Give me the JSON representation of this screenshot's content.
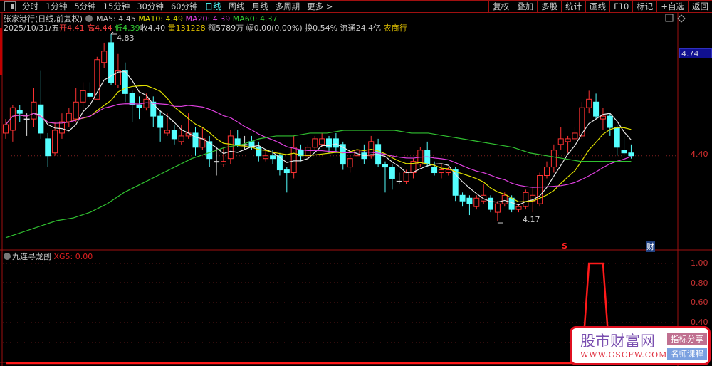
{
  "toolbar": {
    "periods": [
      "分时",
      "1分钟",
      "5分钟",
      "15分钟",
      "30分钟",
      "60分钟",
      "日线",
      "周线",
      "月线",
      "多周期",
      "更多 >"
    ],
    "active": "日线",
    "buttons": [
      "复权",
      "叠加",
      "多股",
      "统计",
      "画线",
      "F10",
      "标记",
      "+自选",
      "返回"
    ]
  },
  "header": {
    "stock": "张家港行(日线,前复权)",
    "ma5": "MA5: 4.45",
    "ma10": "MA10: 4.49",
    "ma20": "MA20: 4.39",
    "ma60": "MA60: 4.37",
    "date": "2025/10/31/五",
    "open_l": "开",
    "open": "4.41",
    "high_l": "高",
    "high": "4.44",
    "low_l": "低",
    "low": "4.39",
    "close_l": "收",
    "close": "4.40",
    "vol_l": "量",
    "vol": "131228",
    "amount": "额5789万",
    "change": "幅0.00(0.00%)",
    "turnover": "换0.54%",
    "float": "流通24.4亿",
    "sector": "农商行"
  },
  "price_axis": {
    "current_label": "4.74",
    "last_label": "4.40"
  },
  "annotations": {
    "high": "4.83",
    "low": "4.17",
    "s_marker": "S",
    "cai_marker": "财"
  },
  "sub": {
    "name": "九连寻龙副",
    "value": "XG5: 0.00",
    "axis": [
      "1.00",
      "0.80",
      "0.60",
      "0.40"
    ]
  },
  "watermark": {
    "title": "股市财富网",
    "url": "WWW.GSCFW.COM",
    "btn1": "指标分享",
    "btn2": "名师课程"
  },
  "colors": {
    "up": "#ff3232",
    "down": "#54ffff",
    "ma5": "#e6e6e6",
    "ma10": "#e0e000",
    "ma20": "#e040e0",
    "ma60": "#30c030",
    "xg5": "#ff1a1a"
  },
  "chart_data": {
    "type": "candlestick",
    "ylim": [
      4.05,
      4.9
    ],
    "ohlc": [
      [
        4.48,
        4.53,
        4.46,
        4.51
      ],
      [
        4.49,
        4.58,
        4.45,
        4.57
      ],
      [
        4.56,
        4.58,
        4.52,
        4.55
      ],
      [
        4.53,
        4.55,
        4.47,
        4.53
      ],
      [
        4.53,
        4.64,
        4.5,
        4.59
      ],
      [
        4.58,
        4.7,
        4.46,
        4.48
      ],
      [
        4.46,
        4.48,
        4.36,
        4.4
      ],
      [
        4.41,
        4.52,
        4.4,
        4.49
      ],
      [
        4.48,
        4.55,
        4.46,
        4.52
      ],
      [
        4.52,
        4.57,
        4.5,
        4.55
      ],
      [
        4.53,
        4.64,
        4.52,
        4.59
      ],
      [
        4.59,
        4.66,
        4.56,
        4.63
      ],
      [
        4.62,
        4.66,
        4.6,
        4.61
      ],
      [
        4.6,
        4.75,
        4.6,
        4.74
      ],
      [
        4.73,
        4.8,
        4.71,
        4.77
      ],
      [
        4.8,
        4.83,
        4.65,
        4.66
      ],
      [
        4.65,
        4.76,
        4.64,
        4.7
      ],
      [
        4.7,
        4.73,
        4.59,
        4.62
      ],
      [
        4.62,
        4.63,
        4.52,
        4.58
      ],
      [
        4.58,
        4.61,
        4.53,
        4.57
      ],
      [
        4.57,
        4.62,
        4.56,
        4.6
      ],
      [
        4.59,
        4.61,
        4.5,
        4.54
      ],
      [
        4.54,
        4.56,
        4.45,
        4.5
      ],
      [
        4.48,
        4.55,
        4.47,
        4.49
      ],
      [
        4.49,
        4.51,
        4.44,
        4.46
      ],
      [
        4.45,
        4.51,
        4.44,
        4.47
      ],
      [
        4.47,
        4.55,
        4.46,
        4.48
      ],
      [
        4.48,
        4.5,
        4.4,
        4.43
      ],
      [
        4.43,
        4.5,
        4.42,
        4.46
      ],
      [
        4.45,
        4.47,
        4.36,
        4.39
      ],
      [
        4.38,
        4.43,
        4.33,
        4.38
      ],
      [
        4.37,
        4.43,
        4.36,
        4.38
      ],
      [
        4.39,
        4.49,
        4.37,
        4.47
      ],
      [
        4.46,
        4.49,
        4.43,
        4.44
      ],
      [
        4.44,
        4.47,
        4.42,
        4.44
      ],
      [
        4.45,
        4.47,
        4.42,
        4.43
      ],
      [
        4.43,
        4.45,
        4.38,
        4.4
      ],
      [
        4.39,
        4.42,
        4.38,
        4.4
      ],
      [
        4.4,
        4.42,
        4.37,
        4.39
      ],
      [
        4.4,
        4.41,
        4.33,
        4.35
      ],
      [
        4.35,
        4.36,
        4.27,
        4.34
      ],
      [
        4.34,
        4.47,
        4.32,
        4.43
      ],
      [
        4.42,
        4.44,
        4.38,
        4.4
      ],
      [
        4.4,
        4.44,
        4.39,
        4.43
      ],
      [
        4.43,
        4.47,
        4.42,
        4.46
      ],
      [
        4.44,
        4.48,
        4.43,
        4.46
      ],
      [
        4.46,
        4.47,
        4.41,
        4.43
      ],
      [
        4.46,
        4.48,
        4.41,
        4.43
      ],
      [
        4.44,
        4.45,
        4.35,
        4.37
      ],
      [
        4.36,
        4.4,
        4.34,
        4.39
      ],
      [
        4.4,
        4.5,
        4.39,
        4.42
      ],
      [
        4.41,
        4.44,
        4.37,
        4.39
      ],
      [
        4.4,
        4.47,
        4.39,
        4.45
      ],
      [
        4.44,
        4.46,
        4.36,
        4.37
      ],
      [
        4.37,
        4.38,
        4.27,
        4.36
      ],
      [
        4.36,
        4.37,
        4.28,
        4.32
      ],
      [
        4.31,
        4.34,
        4.3,
        4.31
      ],
      [
        4.31,
        4.35,
        4.3,
        4.34
      ],
      [
        4.34,
        4.39,
        4.32,
        4.38
      ],
      [
        4.37,
        4.43,
        4.36,
        4.42
      ],
      [
        4.42,
        4.45,
        4.36,
        4.37
      ],
      [
        4.36,
        4.38,
        4.33,
        4.34
      ],
      [
        4.34,
        4.37,
        4.32,
        4.35
      ],
      [
        4.34,
        4.36,
        4.33,
        4.35
      ],
      [
        4.35,
        4.36,
        4.24,
        4.26
      ],
      [
        4.26,
        4.27,
        4.22,
        4.24
      ],
      [
        4.25,
        4.26,
        4.19,
        4.23
      ],
      [
        4.22,
        4.26,
        4.21,
        4.25
      ],
      [
        4.24,
        4.3,
        4.23,
        4.26
      ],
      [
        4.25,
        4.26,
        4.2,
        4.21
      ],
      [
        4.2,
        4.24,
        4.17,
        4.23
      ],
      [
        4.23,
        4.27,
        4.22,
        4.26
      ],
      [
        4.25,
        4.26,
        4.2,
        4.21
      ],
      [
        4.21,
        4.23,
        4.2,
        4.22
      ],
      [
        4.22,
        4.28,
        4.21,
        4.27
      ],
      [
        4.24,
        4.29,
        4.2,
        4.26
      ],
      [
        4.23,
        4.34,
        4.22,
        4.33
      ],
      [
        4.33,
        4.38,
        4.32,
        4.36
      ],
      [
        4.36,
        4.44,
        4.34,
        4.42
      ],
      [
        4.44,
        4.5,
        4.42,
        4.46
      ],
      [
        4.45,
        4.47,
        4.41,
        4.46
      ],
      [
        4.46,
        4.5,
        4.45,
        4.48
      ],
      [
        4.47,
        4.59,
        4.46,
        4.57
      ],
      [
        4.57,
        4.63,
        4.55,
        4.6
      ],
      [
        4.59,
        4.62,
        4.53,
        4.54
      ],
      [
        4.53,
        4.57,
        4.49,
        4.54
      ],
      [
        4.54,
        4.55,
        4.47,
        4.5
      ],
      [
        4.5,
        4.51,
        4.4,
        4.43
      ],
      [
        4.42,
        4.47,
        4.4,
        4.41
      ],
      [
        4.41,
        4.44,
        4.39,
        4.4
      ]
    ],
    "ma60_samples": [
      4.11,
      4.13,
      4.15,
      4.17,
      4.18,
      4.2,
      4.23,
      4.27,
      4.3,
      4.33,
      4.36,
      4.39,
      4.41,
      4.43,
      4.44,
      4.46,
      4.47,
      4.47,
      4.48,
      4.48,
      4.49,
      4.49,
      4.49,
      4.49,
      4.48,
      4.48,
      4.47,
      4.46,
      4.45,
      4.44,
      4.43,
      4.41,
      4.4,
      4.39,
      4.38,
      4.38,
      4.38,
      4.38
    ],
    "xg5": {
      "ylim": [
        0,
        1.1
      ],
      "ones_at_index": [
        83,
        84,
        85
      ]
    }
  }
}
